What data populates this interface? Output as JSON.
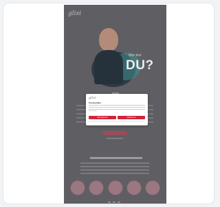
{
  "page": {
    "logo": "glisi",
    "hero_small": "Wer bist",
    "hero_big": "DU?"
  },
  "modal": {
    "logo": "glisi",
    "title": "Privatsphäre",
    "link_text": "Einstellungen",
    "buttons": [
      "Akzeptieren",
      "Ablehnen"
    ]
  },
  "colors": {
    "accent": "#d1243b",
    "overlay_bg": "#5e5e63",
    "card_bg": "#ffffff"
  }
}
